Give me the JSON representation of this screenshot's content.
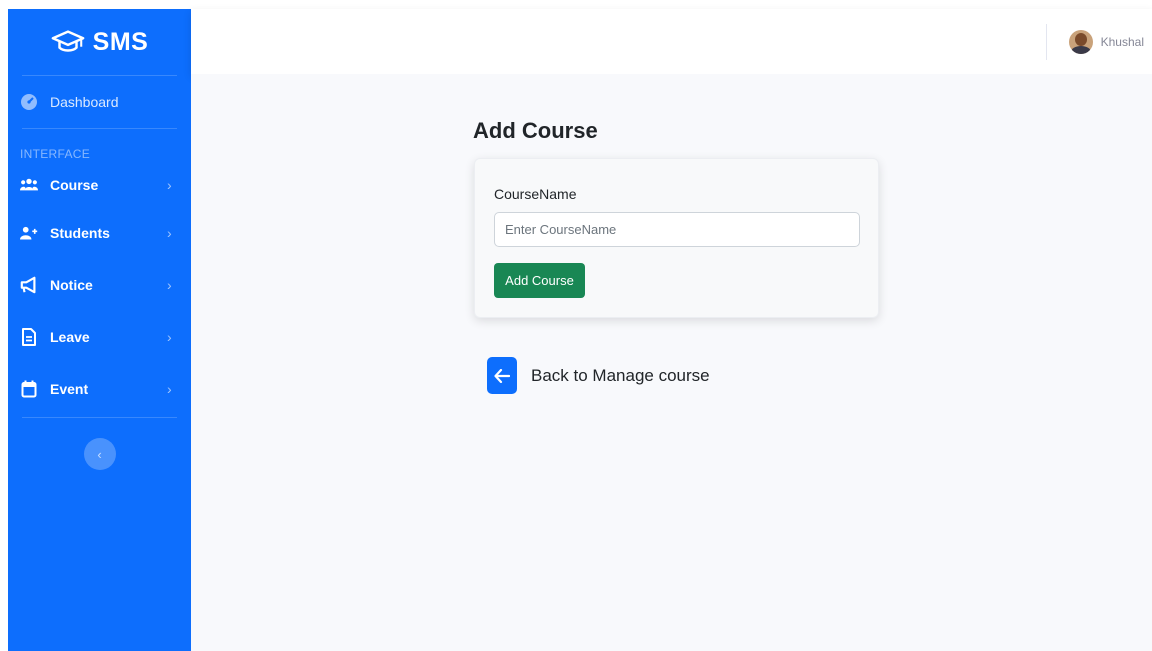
{
  "brand": {
    "name": "SMS",
    "icon": "graduation-cap-icon"
  },
  "sidebar": {
    "dashboard": {
      "label": "Dashboard",
      "icon": "dashboard-gauge-icon"
    },
    "heading": "INTERFACE",
    "items": [
      {
        "label": "Course",
        "icon": "users-group-icon"
      },
      {
        "label": "Students",
        "icon": "user-plus-icon"
      },
      {
        "label": "Notice",
        "icon": "megaphone-icon"
      },
      {
        "label": "Leave",
        "icon": "document-icon"
      },
      {
        "label": "Event",
        "icon": "calendar-icon"
      }
    ]
  },
  "topbar": {
    "user_name": "Khushal"
  },
  "main": {
    "title": "Add Course",
    "form": {
      "label": "CourseName",
      "placeholder": "Enter CourseName",
      "value": "",
      "submit_label": "Add Course"
    },
    "back_link": "Back to Manage course"
  },
  "colors": {
    "primary": "#0d6efd",
    "success": "#198754",
    "background": "#f8f9fc"
  }
}
